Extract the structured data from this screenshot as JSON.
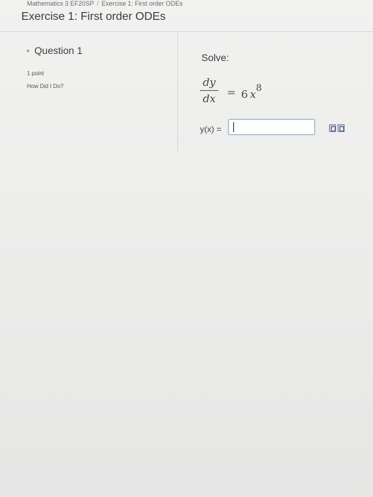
{
  "header": {
    "breadcrumb": [
      "Mathematics 3 EF20SP",
      "Exercise 1: First order ODEs"
    ],
    "title": "Exercise 1: First order ODEs"
  },
  "question": {
    "heading": "Question 1",
    "points": "1 point",
    "how_did_i_do": "How Did I Do?"
  },
  "problem": {
    "prompt": "Solve:",
    "numerator": "dy",
    "denominator": "dx",
    "equals": "=",
    "coefficient": "6",
    "variable": "x",
    "exponent": "8",
    "answer_label": "y(x) =",
    "answer_value": ""
  },
  "icons": [
    "caret-icon",
    "equation-editor-icon",
    "preview-icon"
  ]
}
